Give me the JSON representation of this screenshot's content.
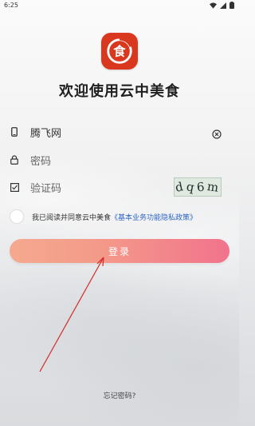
{
  "status_bar": {
    "time": "6:25"
  },
  "app": {
    "title": "欢迎使用云中美食",
    "logo_glyph": "食"
  },
  "form": {
    "username_value": "腾飞网",
    "password_placeholder": "密码",
    "captcha_placeholder": "验证码",
    "captcha_chars": [
      "d",
      "q",
      "6",
      "m"
    ]
  },
  "agreement": {
    "text": "我已阅读并同意云中美食",
    "link": "《基本业务功能隐私政策》"
  },
  "buttons": {
    "login": "登录",
    "forgot": "忘记密码?"
  },
  "colors": {
    "logo": "#d9381e",
    "button_start": "#f5a98f",
    "button_end": "#f1738c",
    "link": "#2f66c8",
    "annotation_arrow": "#d42a2a"
  },
  "icons": {
    "phone": "phone-icon",
    "lock": "lock-icon",
    "captcha": "checklist-icon",
    "clear": "clear-icon"
  }
}
